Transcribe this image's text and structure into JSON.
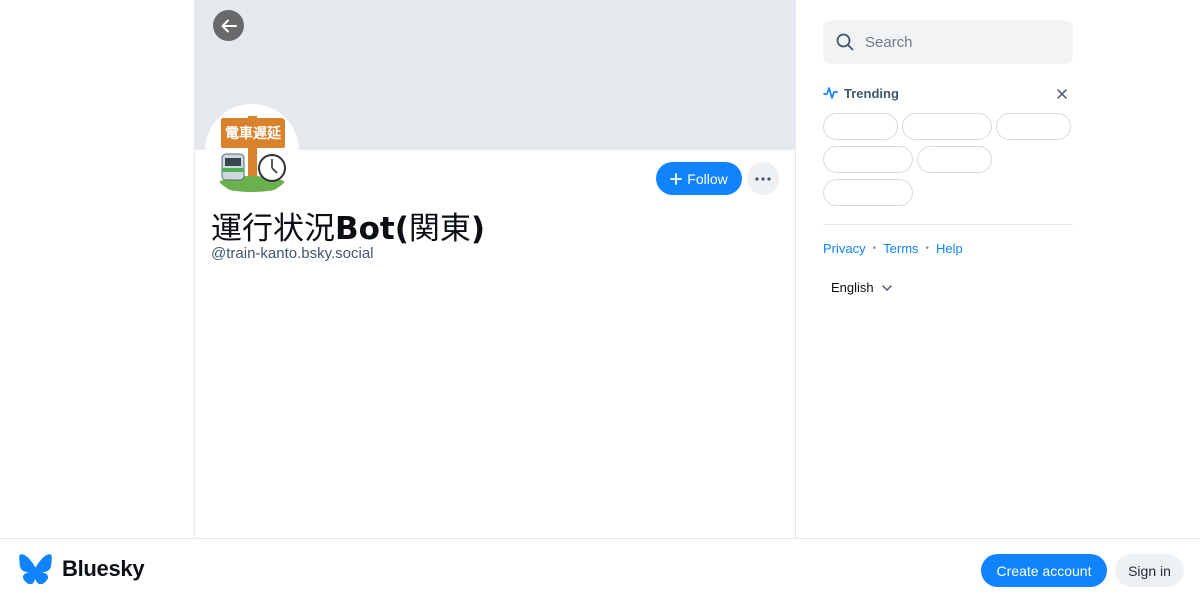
{
  "profile": {
    "display_name_jp": "運行状況",
    "display_name_bot": "Bot(",
    "display_name_jp2": "関東",
    "display_name_end": ")",
    "handle": "@train-kanto.bsky.social",
    "avatar_sign_text": "電車遅延",
    "follow_label": "Follow"
  },
  "sidebar": {
    "search_placeholder": "Search",
    "trending_title": "Trending",
    "links": [
      "Privacy",
      "Terms",
      "Help"
    ],
    "language": "English"
  },
  "bottom_bar": {
    "brand_name": "Bluesky",
    "create_account_label": "Create account",
    "sign_in_label": "Sign in"
  },
  "colors": {
    "accent": "#1083fe",
    "banner": "#e5e9ee"
  },
  "icons": [
    "back-arrow-icon",
    "plus-icon",
    "ellipsis-icon",
    "search-icon",
    "trending-icon",
    "close-icon",
    "chevron-down-icon",
    "butterfly-logo-icon"
  ]
}
